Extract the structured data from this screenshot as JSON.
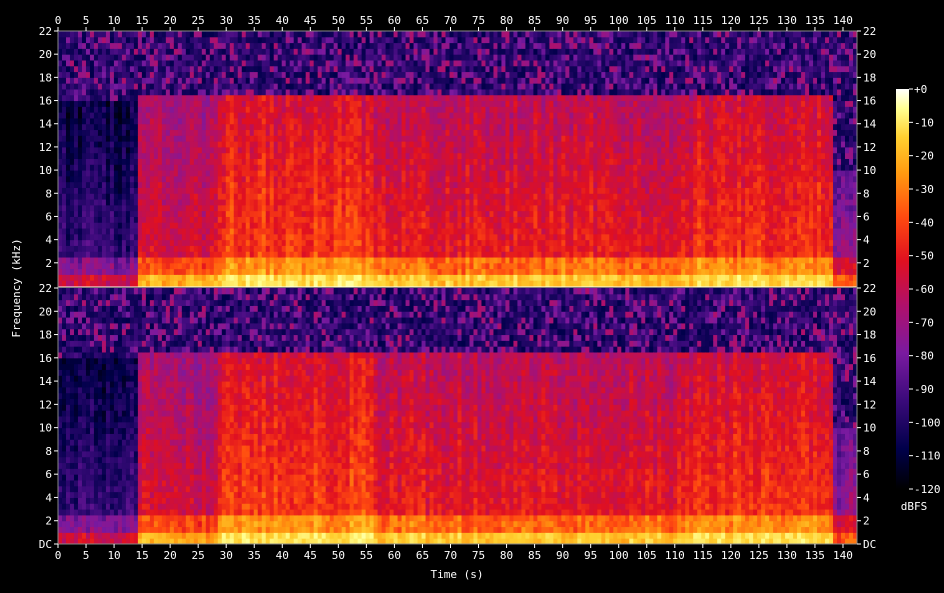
{
  "chart_data": {
    "type": "heatmap",
    "subtype": "spectrogram",
    "xlabel": "Time (s)",
    "ylabel": "Frequency (kHz)",
    "colorbar_label": "dBFS",
    "x_ticks": [
      0,
      5,
      10,
      15,
      20,
      25,
      30,
      35,
      40,
      45,
      50,
      55,
      60,
      65,
      70,
      75,
      80,
      85,
      90,
      95,
      100,
      105,
      110,
      115,
      120,
      125,
      130,
      135,
      140
    ],
    "xlim": [
      0,
      142.5
    ],
    "ylim": [
      0,
      22
    ],
    "channels": [
      {
        "y_ticks": [
          "2",
          "4",
          "6",
          "8",
          "10",
          "12",
          "14",
          "16",
          "18",
          "20",
          "22"
        ]
      },
      {
        "y_ticks": [
          "DC",
          "2",
          "4",
          "6",
          "8",
          "10",
          "12",
          "14",
          "16",
          "18",
          "20",
          "22"
        ]
      }
    ],
    "colorbar_ticks": [
      "+0",
      "-10",
      "-20",
      "-30",
      "-40",
      "-50",
      "-60",
      "-70",
      "-80",
      "-90",
      "-100",
      "-110",
      "-120"
    ],
    "colorbar_range": [
      -120,
      0
    ],
    "colormap": [
      "#000000",
      "#00004a",
      "#3a0a7a",
      "#7a1aa0",
      "#b0106a",
      "#e01020",
      "#ff4a10",
      "#ff9a10",
      "#ffd030",
      "#ffff90",
      "#ffffff"
    ],
    "segments": [
      {
        "t_start": 0,
        "t_end": 14,
        "cutoff_khz": 16.0,
        "level_db": -95
      },
      {
        "t_start": 14,
        "t_end": 28.5,
        "cutoff_khz": 16.5,
        "level_db": -62
      },
      {
        "t_start": 28.5,
        "t_end": 56.5,
        "cutoff_khz": 16.5,
        "level_db": -48
      },
      {
        "t_start": 56.5,
        "t_end": 113.5,
        "cutoff_khz": 16.5,
        "level_db": -55
      },
      {
        "t_start": 113.5,
        "t_end": 138,
        "cutoff_khz": 16.5,
        "level_db": -50
      },
      {
        "t_start": 138,
        "t_end": 142.5,
        "cutoff_khz": 10.0,
        "level_db": -75
      }
    ]
  }
}
